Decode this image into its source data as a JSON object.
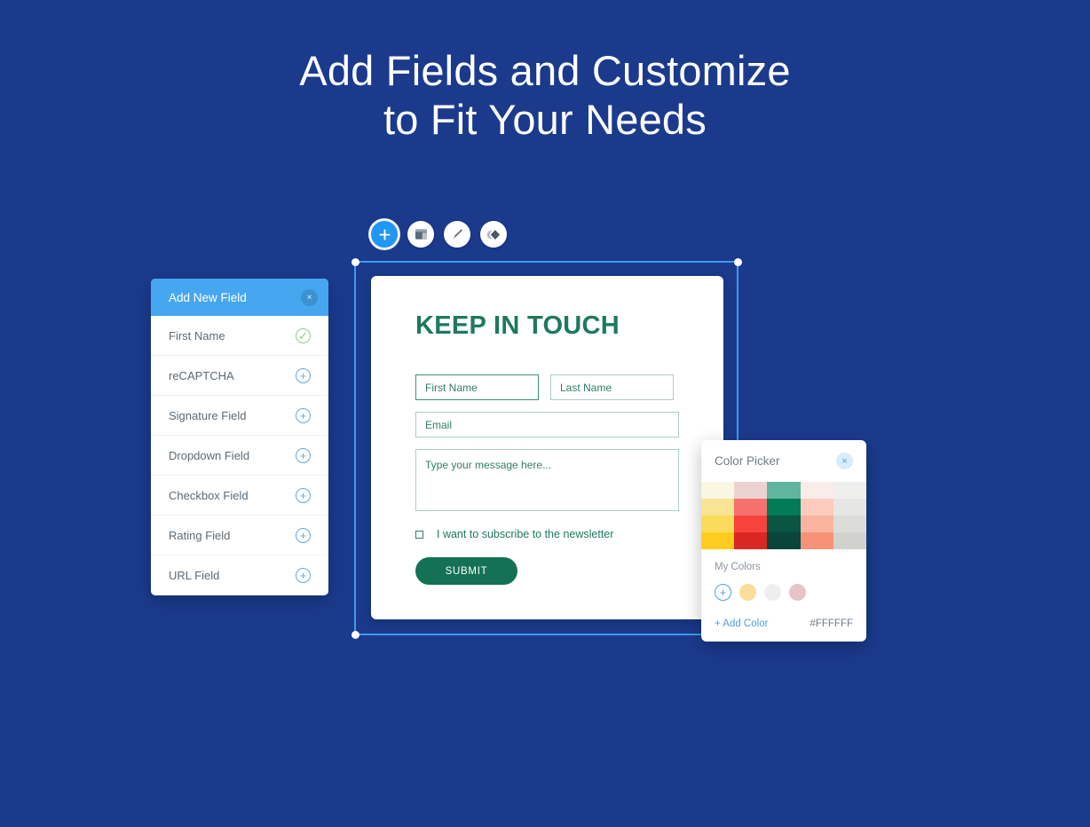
{
  "page": {
    "background_color": "#1b3a8c",
    "headline_line1": "Add Fields and Customize",
    "headline_line2": "to Fit Your Needs"
  },
  "toolbar": {
    "items": [
      {
        "name": "add-icon",
        "label": "Add",
        "active": true
      },
      {
        "name": "layout-icon",
        "label": "Layout",
        "active": false
      },
      {
        "name": "brush-icon",
        "label": "Style",
        "active": false
      },
      {
        "name": "layers-icon",
        "label": "Layers",
        "active": false
      }
    ]
  },
  "field_panel": {
    "title": "Add New Field",
    "close_label": "×",
    "rows": [
      {
        "label": "First Name",
        "action": "✓",
        "state": "added"
      },
      {
        "label": "reCAPTCHA",
        "action": "+",
        "state": "available"
      },
      {
        "label": "Signature Field",
        "action": "+",
        "state": "available"
      },
      {
        "label": "Dropdown Field",
        "action": "+",
        "state": "available"
      },
      {
        "label": "Checkbox Field",
        "action": "+",
        "state": "available"
      },
      {
        "label": "Rating Field",
        "action": "+",
        "state": "available"
      },
      {
        "label": "URL Field",
        "action": "+",
        "state": "available"
      }
    ]
  },
  "form": {
    "title": "KEEP IN TOUCH",
    "first_name_placeholder": "First Name",
    "last_name_placeholder": "Last Name",
    "email_placeholder": "Email",
    "message_placeholder": "Type your message here...",
    "checkbox_label": "I want to subscribe to the newsletter",
    "submit_label": "SUBMIT",
    "accent_color": "#147154"
  },
  "color_picker": {
    "title": "Color Picker",
    "close_label": "×",
    "my_colors_label": "My Colors",
    "add_color_label": "+ Add Color",
    "hex_value": "#FFFFFF",
    "swatches": [
      "#faf6e2",
      "#edd2d2",
      "#60b5a0",
      "#faece8",
      "#efefee",
      "#f8e493",
      "#f4716d",
      "#037a58",
      "#fccbbb",
      "#e6e6e5",
      "#fadc5a",
      "#f8423c",
      "#0a5543",
      "#f9b5a0",
      "#dcdcd8",
      "#ffcd1f",
      "#da2722",
      "#08453a",
      "#f79276",
      "#d1d2cd"
    ],
    "my_colors": [
      {
        "name": "add-color-swatch",
        "color": "#ffffff"
      },
      {
        "name": "swatch-yellow",
        "color": "#fbdd9a"
      },
      {
        "name": "swatch-gray",
        "color": "#eeeeec"
      },
      {
        "name": "swatch-pink",
        "color": "#e8c2c9"
      }
    ]
  },
  "selection": {
    "border_color": "#3d9bf0",
    "handle_color": "#ffffff"
  }
}
